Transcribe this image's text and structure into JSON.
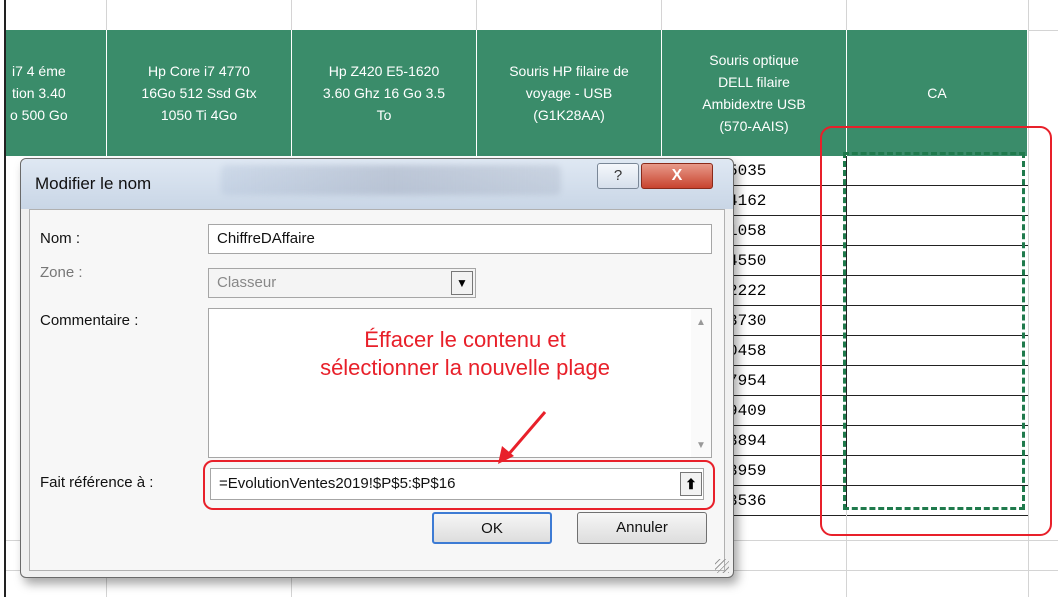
{
  "spreadsheet": {
    "headers": [
      {
        "name": "col-1",
        "text": "i7 4 éme\ntion 3.40\no 500 Go"
      },
      {
        "name": "col-2",
        "text": "Hp Core i7 4770\n16Go 512 Ssd Gtx\n1050 Ti 4Go"
      },
      {
        "name": "col-3",
        "text": "Hp Z420 E5-1620\n3.60 Ghz 16 Go 3.5\nTo"
      },
      {
        "name": "col-4",
        "text": "Souris HP filaire de\nvoyage - USB\n(G1K28AA)"
      },
      {
        "name": "col-5",
        "text": "Souris optique\nDELL filaire\nAmbidextre USB\n(570-AAIS)"
      },
      {
        "name": "col-ca",
        "text": "CA"
      }
    ],
    "visible_values": [
      "5035",
      "4162",
      "1058",
      "4550",
      "2222",
      "3730",
      "0458",
      "7954",
      "9409",
      "3894",
      "3959",
      "3536"
    ]
  },
  "dialog": {
    "title": "Modifier le nom",
    "help_label": "?",
    "close_label": "X",
    "nom_label": "Nom :",
    "nom_value": "ChiffreDAffaire",
    "zone_label": "Zone :",
    "zone_value": "Classeur",
    "commentaire_label": "Commentaire :",
    "reference_label": "Fait référence à :",
    "reference_value": "=EvolutionVentes2019!$P$5:$P$16",
    "ok_label": "OK",
    "cancel_label": "Annuler"
  },
  "annotation": {
    "line1": "Éffacer le contenu et",
    "line2": "sélectionner la nouvelle plage"
  },
  "colors": {
    "header_green": "#3a8c6a",
    "annotation_red": "#e8202a",
    "marching_ants": "#1f7a4c"
  }
}
